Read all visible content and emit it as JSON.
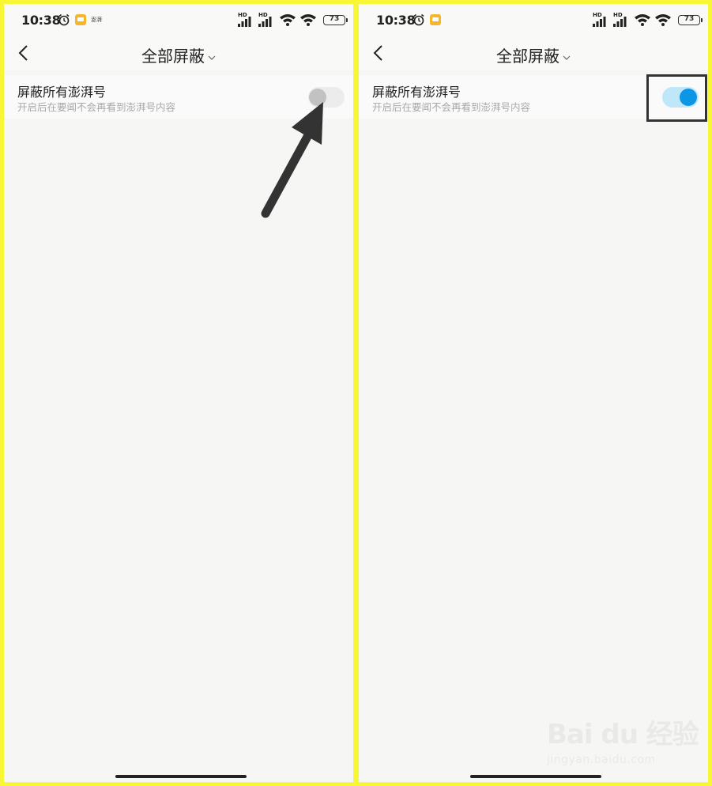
{
  "status_bar": {
    "time": "10:38",
    "app_label": "澎湃",
    "sim1": "HD",
    "sim2": "HD",
    "battery": "73"
  },
  "nav": {
    "title": "全部屏蔽"
  },
  "setting": {
    "title": "屏蔽所有澎湃号",
    "description": "开启后在要闻不会再看到澎湃号内容"
  },
  "panels": [
    {
      "toggle_state": "off"
    },
    {
      "toggle_state": "on"
    }
  ],
  "watermark": {
    "logo": "Bai du 经验",
    "url": "jingyan.baidu.com"
  },
  "colors": {
    "border": "#f7f735",
    "switch_on_track": "#bfe6f9",
    "switch_on_knob": "#0b97e6",
    "switch_off_track": "#ececec",
    "switch_off_knob": "#c2c2c2"
  }
}
